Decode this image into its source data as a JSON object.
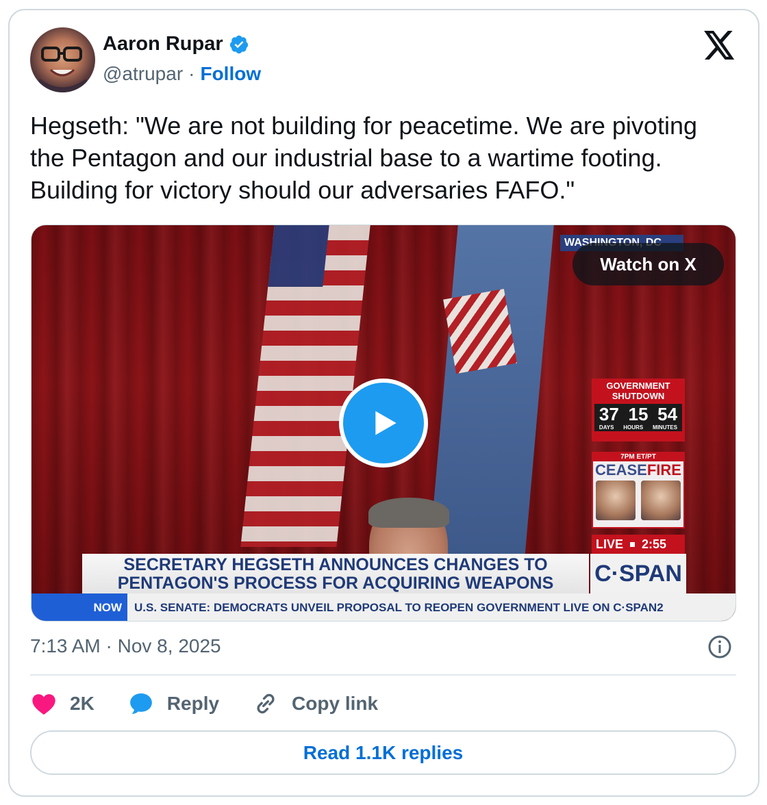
{
  "author": {
    "name": "Aaron Rupar",
    "handle": "@atrupar",
    "separator": "·",
    "follow_label": "Follow",
    "verified": true
  },
  "tweet": {
    "text": "Hegseth: \"We are not building for peacetime. We are pivoting the Pentagon and our industrial base to a wartime footing. Building for victory should our adversaries FAFO.\"",
    "timestamp": "7:13 AM · Nov 8, 2025"
  },
  "media": {
    "watch_label": "Watch on X",
    "location_bug": "WASHINGTON, DC",
    "shutdown": {
      "title_line1": "GOVERNMENT",
      "title_line2": "SHUTDOWN",
      "days": "37",
      "hours": "15",
      "minutes": "54",
      "days_label": "DAYS",
      "hours_label": "HOURS",
      "minutes_label": "MINUTES"
    },
    "ceasefire": {
      "time": "7PM ET/PT",
      "cease": "CEASE",
      "fire": "FIRE"
    },
    "live_label": "LIVE",
    "live_time": "2:55",
    "headline_line1": "SECRETARY HEGSETH ANNOUNCES CHANGES TO",
    "headline_line2": "PENTAGON'S PROCESS FOR ACQUIRING WEAPONS",
    "network": "C·SPAN",
    "ticker_label": "NOW",
    "ticker_text": "U.S. SENATE: DEMOCRATS UNVEIL PROPOSAL TO REOPEN GOVERNMENT  LIVE ON C·SPAN2"
  },
  "actions": {
    "likes": "2K",
    "reply_label": "Reply",
    "copy_label": "Copy link"
  },
  "read_replies_label": "Read 1.1K replies",
  "colors": {
    "link_blue": "#006fd6",
    "play_blue": "#1d9bf0",
    "heart_pink": "#f91880",
    "reply_blue": "#1d9bf0",
    "secondary_text": "#536471",
    "border": "#cfd9de"
  }
}
